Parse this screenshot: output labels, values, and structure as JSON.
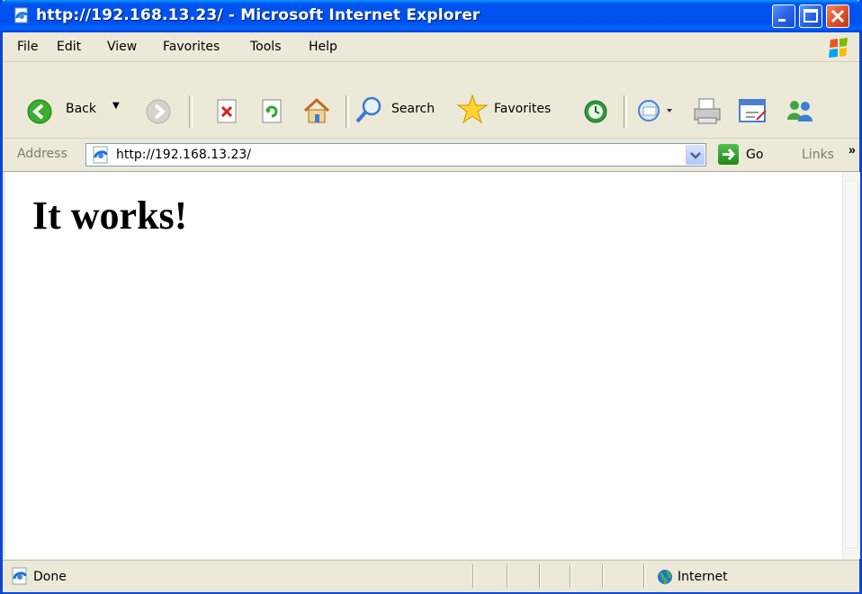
{
  "window": {
    "title": "http://192.168.13.23/ - Microsoft Internet Explorer"
  },
  "menu": {
    "items": [
      "File",
      "Edit",
      "View",
      "Favorites",
      "Tools",
      "Help"
    ]
  },
  "toolbar": {
    "back_label": "Back",
    "search_label": "Search",
    "favorites_label": "Favorites"
  },
  "address": {
    "label": "Address",
    "value": "http://192.168.13.23/",
    "go_label": "Go",
    "links_label": "Links",
    "links_more": "»"
  },
  "content": {
    "heading": "It works!"
  },
  "status": {
    "text": "Done",
    "zone": "Internet"
  },
  "icons": {
    "page": "ie-page-icon",
    "minimize": "minimize-icon",
    "maximize": "maximize-icon",
    "close": "close-icon",
    "back": "back-arrow-icon",
    "forward": "forward-arrow-icon",
    "stop": "stop-icon",
    "refresh": "refresh-icon",
    "home": "home-icon",
    "search": "search-icon",
    "favorites": "star-icon",
    "history": "history-icon",
    "mail": "mail-icon",
    "print": "print-icon",
    "edit": "edit-icon",
    "messenger": "messenger-icon",
    "go": "go-arrow-icon",
    "globe": "globe-icon"
  }
}
